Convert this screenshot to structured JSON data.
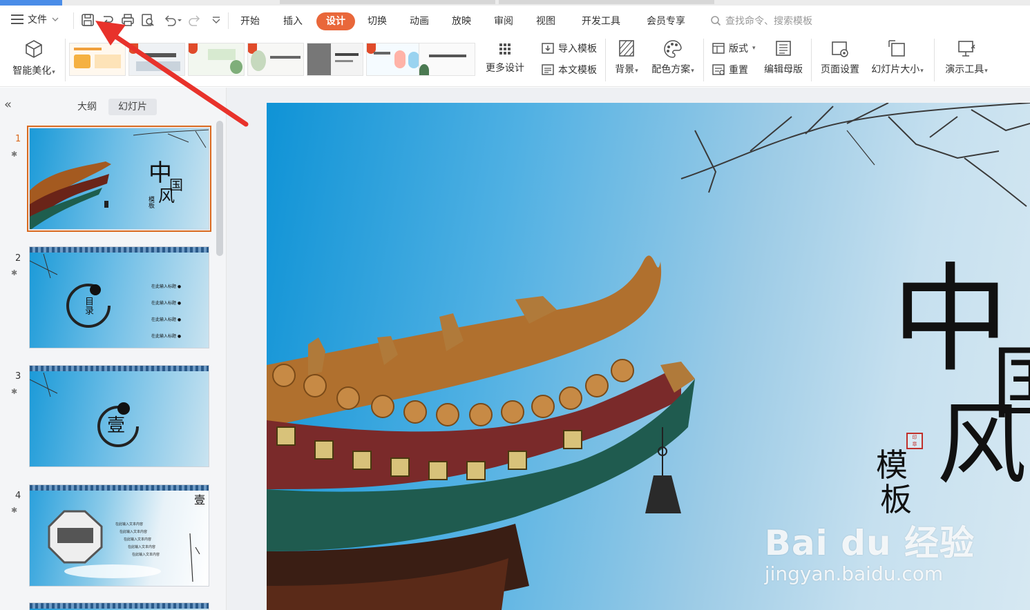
{
  "menu": {
    "file_label": "文件",
    "tabs": [
      "开始",
      "插入",
      "设计",
      "切换",
      "动画",
      "放映",
      "审阅",
      "视图",
      "开发工具",
      "会员专享"
    ],
    "active_tab": "设计",
    "search_placeholder": "查找命令、搜索模板"
  },
  "ribbon": {
    "smart_beautify": "智能美化",
    "more_design": "更多设计",
    "import_template": "导入模板",
    "this_template": "本文模板",
    "background": "背景",
    "color_scheme": "配色方案",
    "layout": "版式",
    "reset": "重置",
    "edit_master": "编辑母版",
    "page_setup": "页面设置",
    "slide_size": "幻灯片大小",
    "presentation_tools": "演示工具"
  },
  "panel": {
    "tab_outline": "大纲",
    "tab_slides": "幻灯片",
    "active_tab": "幻灯片"
  },
  "slides": [
    {
      "number": "1",
      "title_chars": [
        "中",
        "国",
        "风"
      ],
      "sub": "模板"
    },
    {
      "number": "2",
      "title": "目录",
      "items": [
        "在此输入标题",
        "在此输入标题",
        "在此输入标题",
        "在此输入标题"
      ]
    },
    {
      "number": "3",
      "title": "壹"
    },
    {
      "number": "4",
      "title": "壹",
      "items": [
        "在此输入文本内容",
        "在此输入文本内容",
        "在此输入文本内容",
        "在此输入文本内容",
        "在此输入文本内容"
      ]
    }
  ],
  "current_slide": {
    "char1": "中",
    "char2": "国",
    "char3": "风",
    "sub1": "模",
    "sub2": "板"
  },
  "watermark": {
    "main": "Bai du 经验",
    "sub": "jingyan.baidu.com"
  },
  "colors": {
    "accent": "#e9673a",
    "active_slide_border": "#d9691f",
    "arrow": "#e8322b"
  }
}
